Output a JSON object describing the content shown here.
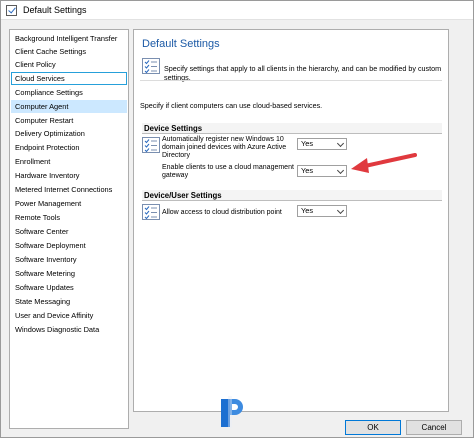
{
  "window": {
    "title": "Default Settings"
  },
  "nav": {
    "items": [
      "Background Intelligent Transfer",
      "Client Cache Settings",
      "Client Policy",
      "Cloud Services",
      "Compliance Settings",
      "Computer Agent",
      "Computer Restart",
      "Delivery Optimization",
      "Endpoint Protection",
      "Enrollment",
      "Hardware Inventory",
      "Metered Internet Connections",
      "Power Management",
      "Remote Tools",
      "Software Center",
      "Software Deployment",
      "Software Inventory",
      "Software Metering",
      "Software Updates",
      "State Messaging",
      "User and Device Affinity",
      "Windows Diagnostic Data"
    ],
    "focused_item": "Cloud Services",
    "selected_item": "Computer Agent"
  },
  "panel": {
    "heading": "Default Settings",
    "description": "Specify settings that apply to all clients in the hierarchy, and can be modified by custom settings.",
    "section_description": "Specify if client computers can use cloud-based services.",
    "groups": [
      {
        "header": "Device Settings",
        "settings": [
          {
            "label": "Automatically register new Windows 10 domain joined devices with Azure Active Directory",
            "value": "Yes"
          },
          {
            "label": "Enable clients to use a cloud management gateway",
            "value": "Yes"
          }
        ]
      },
      {
        "header": "Device/User Settings",
        "settings": [
          {
            "label": "Allow access to cloud distribution point",
            "value": "Yes"
          }
        ]
      }
    ]
  },
  "buttons": {
    "ok": "OK",
    "cancel": "Cancel"
  },
  "colors": {
    "heading": "#1c5aa6",
    "selection": "#cce8ff",
    "focus_border": "#26a0da",
    "annotation_arrow": "#e0393e"
  }
}
